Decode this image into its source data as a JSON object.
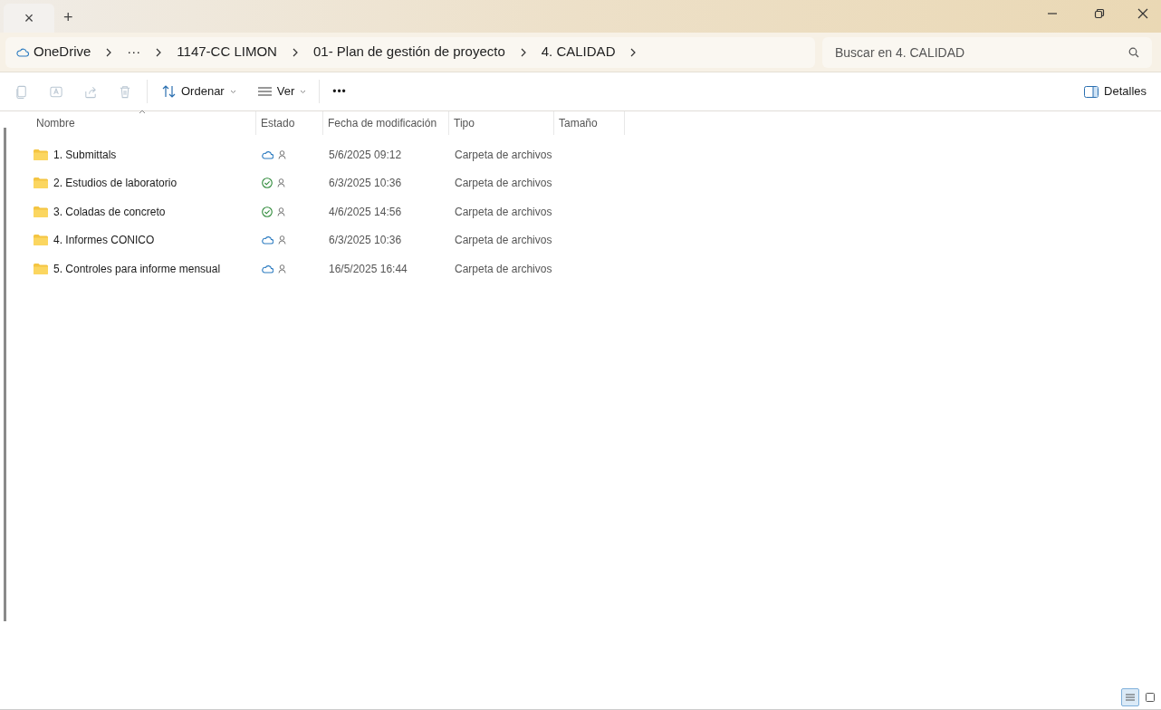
{
  "tab_bar": {
    "close": "×",
    "new_tab": "+"
  },
  "address_bar": {
    "crumbs": [
      {
        "label": "OneDrive",
        "kind": "cloud"
      },
      {
        "label": "···",
        "kind": "plain"
      },
      {
        "label": "1147-CC LIMON",
        "kind": "plain"
      },
      {
        "label": "01- Plan de gestión de proyecto",
        "kind": "plain"
      },
      {
        "label": "4. CALIDAD",
        "kind": "plain"
      }
    ]
  },
  "search": {
    "placeholder": "Buscar en 4. CALIDAD"
  },
  "toolbar": {
    "actions": [
      {
        "kind": "copy",
        "disabled": true
      },
      {
        "kind": "rename",
        "disabled": true
      },
      {
        "kind": "share",
        "disabled": true
      },
      {
        "kind": "delete",
        "disabled": true
      }
    ],
    "sort": "Ordenar",
    "view": "Ver",
    "more": "•••",
    "details": "Detalles"
  },
  "table": {
    "columns": [
      "Nombre",
      "Estado",
      "Fecha de modificación",
      "Tipo",
      "Tamaño"
    ],
    "rows": [
      {
        "name": "1. Submittals",
        "kind": "cloud",
        "date": "5/6/2025 09:12",
        "type": "Carpeta de archivos"
      },
      {
        "name": "2. Estudios de laboratorio",
        "kind": "synced",
        "date": "6/3/2025 10:36",
        "type": "Carpeta de archivos"
      },
      {
        "name": "3. Coladas de concreto",
        "kind": "synced",
        "date": "4/6/2025 14:56",
        "type": "Carpeta de archivos"
      },
      {
        "name": "4. Informes CONICO",
        "kind": "cloud",
        "date": "6/3/2025 10:36",
        "type": "Carpeta de archivos"
      },
      {
        "name": "5. Controles para informe mensual",
        "kind": "cloud",
        "date": "16/5/2025 16:44",
        "type": "Carpeta de archivos"
      }
    ]
  },
  "view_toggle": [
    {
      "kind": "details",
      "selected": true
    },
    {
      "kind": "tiles",
      "selected": false
    }
  ]
}
